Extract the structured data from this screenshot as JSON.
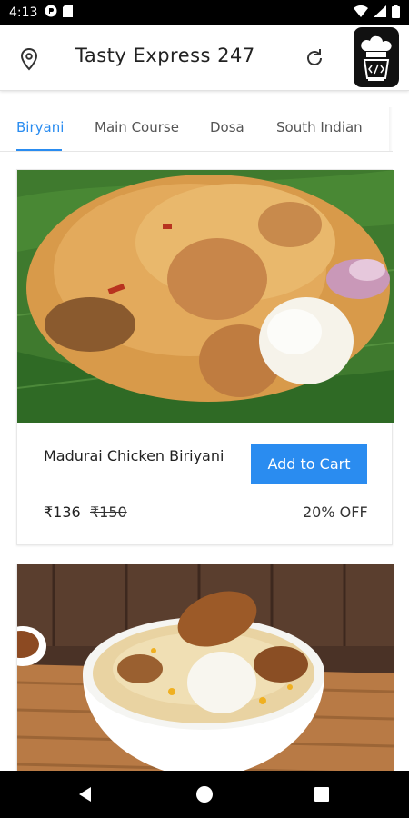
{
  "status_bar": {
    "time": "4:13"
  },
  "app_bar": {
    "title": "Tasty Express 247"
  },
  "tabs": [
    {
      "label": "Biryani",
      "active": true
    },
    {
      "label": "Main Course",
      "active": false
    },
    {
      "label": "Dosa",
      "active": false
    },
    {
      "label": "South Indian",
      "active": false
    }
  ],
  "items": [
    {
      "name": "Madurai Chicken Biriyani",
      "add_to_cart_label": "Add to Cart",
      "price": "₹136",
      "old_price": "₹150",
      "discount": "20% OFF"
    }
  ],
  "icons": {
    "location": "location-pin-icon",
    "refresh": "refresh-icon",
    "logo": "chef-hat-logo",
    "back": "back-triangle-icon",
    "home": "home-circle-icon",
    "recents": "recents-square-icon"
  },
  "colors": {
    "accent": "#2a8cf0",
    "status_bar": "#000000",
    "nav_bar": "#000000"
  }
}
